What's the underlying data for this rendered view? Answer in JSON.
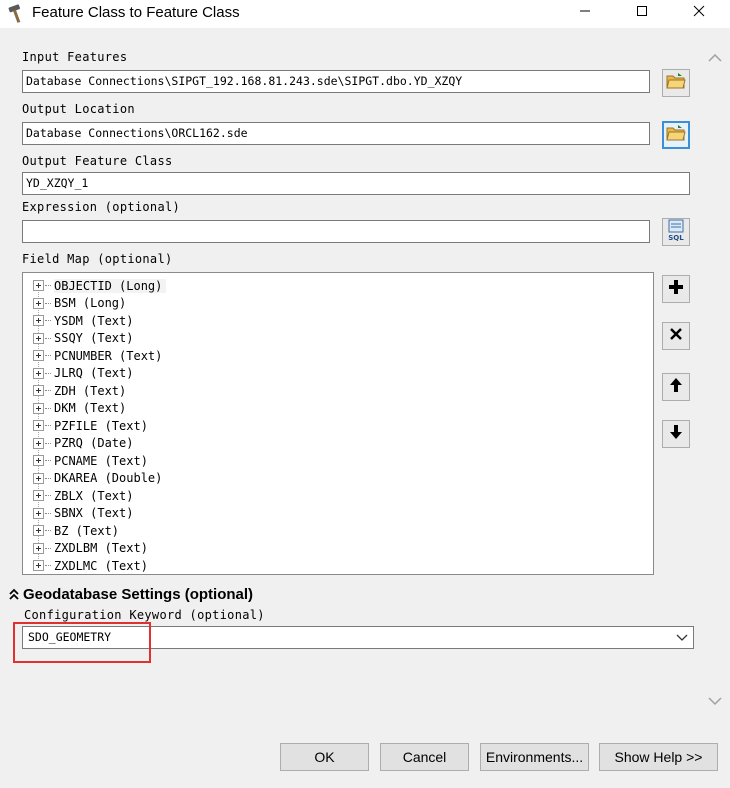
{
  "window": {
    "title": "Feature Class to Feature Class"
  },
  "title_icons": {
    "app": "hammer-icon",
    "minimize": "minimize-icon",
    "maximize": "maximize-icon",
    "close": "close-icon"
  },
  "form": {
    "input_features": {
      "label": "Input Features",
      "value": "Database Connections\\SIPGT_192.168.81.243.sde\\SIPGT.dbo.YD_XZQY"
    },
    "output_location": {
      "label": "Output Location",
      "value": "Database Connections\\ORCL162.sde"
    },
    "output_feature_class": {
      "label": "Output Feature Class",
      "value": "YD_XZQY_1"
    },
    "expression": {
      "label": "Expression (optional)",
      "value": ""
    },
    "field_map": {
      "label": "Field Map (optional)",
      "items": [
        "OBJECTID (Long)",
        "BSM (Long)",
        "YSDM (Text)",
        "SSQY (Text)",
        "PCNUMBER (Text)",
        "JLRQ (Text)",
        "ZDH (Text)",
        "DKM (Text)",
        "PZFILE (Text)",
        "PZRQ (Date)",
        "PCNAME (Text)",
        "DKAREA (Double)",
        "ZBLX (Text)",
        "SBNX (Text)",
        "BZ (Text)",
        "ZXDLBM (Text)",
        "ZXDLMC (Text)"
      ]
    }
  },
  "geodatabase": {
    "section_title": "Geodatabase Settings (optional)",
    "config_keyword": {
      "label": "Configuration Keyword (optional)",
      "value": "SDO_GEOMETRY"
    }
  },
  "buttons": {
    "ok": "OK",
    "cancel": "Cancel",
    "environments": "Environments...",
    "show_help": "Show Help >>"
  },
  "colors": {
    "highlight_border": "#e03030",
    "active_browse": "#3b8fd6"
  }
}
